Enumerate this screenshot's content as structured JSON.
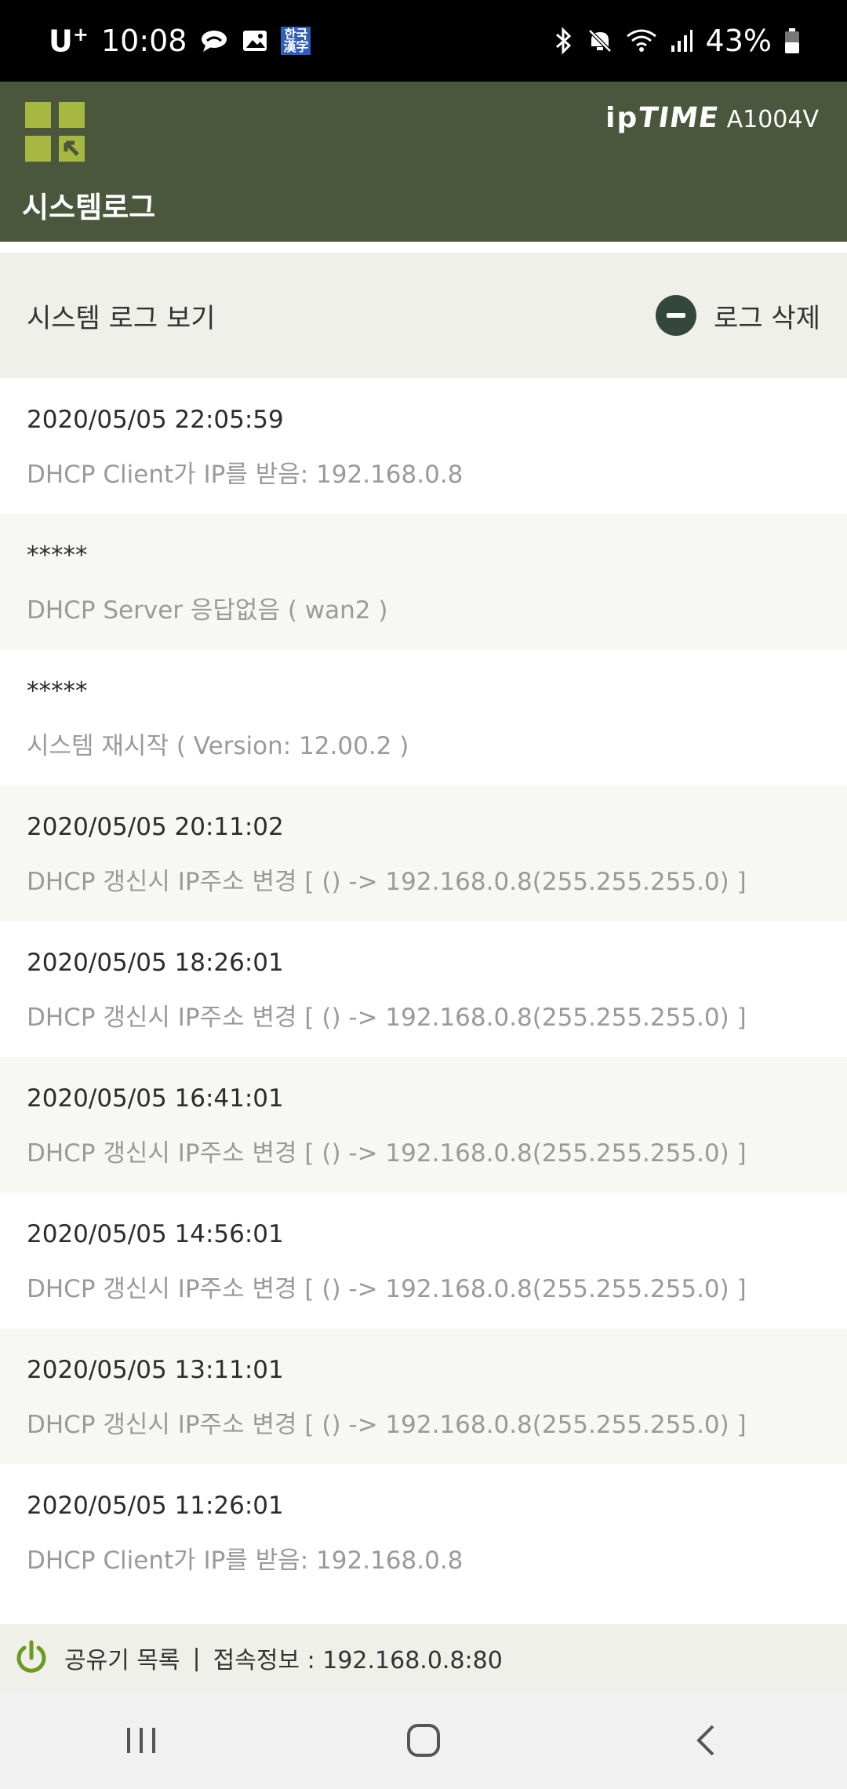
{
  "status_bar": {
    "carrier": "U",
    "carrier_sup": "+",
    "time": "10:08",
    "keyboard_badge": "한국\n漢字",
    "battery": "43%"
  },
  "header": {
    "brand_ip": "ip",
    "brand_time": "TIME",
    "model": "A1004V",
    "title": "시스템로그",
    "accent": "#a6b83f",
    "bg": "#4a573c"
  },
  "section": {
    "title": "시스템 로그 보기",
    "delete_label": "로그 삭제"
  },
  "logs": [
    {
      "time": "2020/05/05 22:05:59",
      "message": "DHCP Client가 IP를 받음: 192.168.0.8"
    },
    {
      "time": "*****",
      "message": "DHCP Server 응답없음 ( wan2 )"
    },
    {
      "time": "*****",
      "message": "시스템 재시작 ( Version: 12.00.2 )"
    },
    {
      "time": "2020/05/05 20:11:02",
      "message": "DHCP 갱신시 IP주소 변경 [ () -> 192.168.0.8(255.255.255.0) ]"
    },
    {
      "time": "2020/05/05 18:26:01",
      "message": "DHCP 갱신시 IP주소 변경 [ () -> 192.168.0.8(255.255.255.0) ]"
    },
    {
      "time": "2020/05/05 16:41:01",
      "message": "DHCP 갱신시 IP주소 변경 [ () -> 192.168.0.8(255.255.255.0) ]"
    },
    {
      "time": "2020/05/05 14:56:01",
      "message": "DHCP 갱신시 IP주소 변경 [ () -> 192.168.0.8(255.255.255.0) ]"
    },
    {
      "time": "2020/05/05 13:11:01",
      "message": "DHCP 갱신시 IP주소 변경 [ () -> 192.168.0.8(255.255.255.0) ]"
    },
    {
      "time": "2020/05/05 11:26:01",
      "message": "DHCP Client가 IP를 받음: 192.168.0.8"
    }
  ],
  "footer": {
    "router_list": "공유기 목록",
    "separator": "|",
    "connection_info": "접속정보 : 192.168.0.8:80"
  }
}
